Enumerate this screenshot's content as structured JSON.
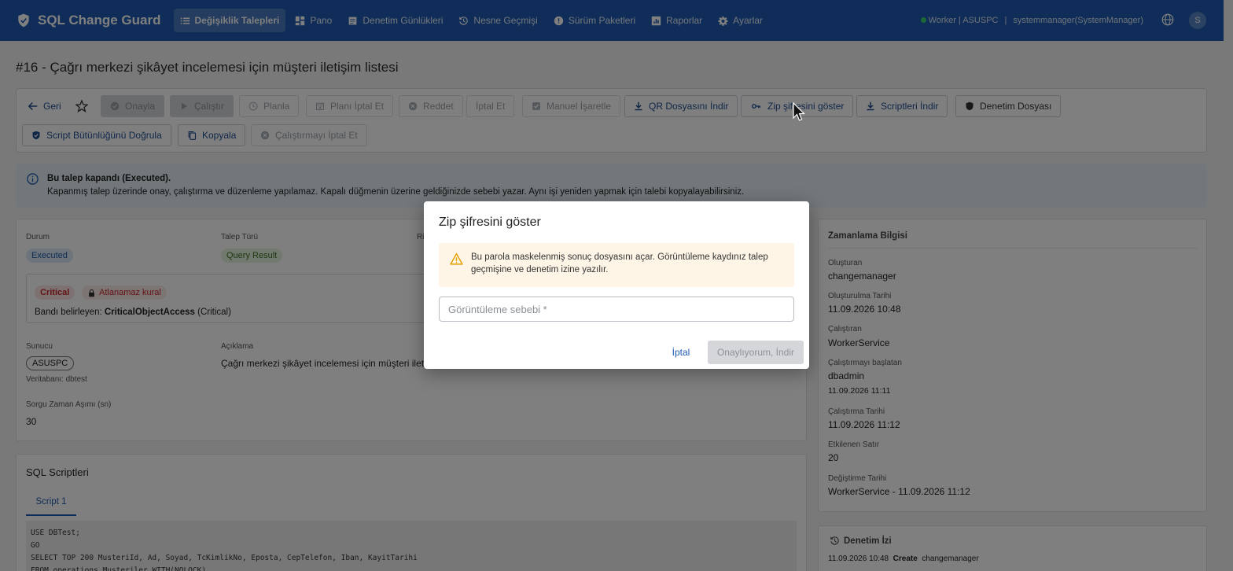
{
  "navbar": {
    "brand": "SQL Change Guard",
    "items": [
      {
        "label": "Değişiklik Talepleri",
        "icon": "list-icon",
        "active": true
      },
      {
        "label": "Pano",
        "icon": "dashboard-icon"
      },
      {
        "label": "Denetim Günlükleri",
        "icon": "log-icon"
      },
      {
        "label": "Nesne Geçmişi",
        "icon": "history-icon"
      },
      {
        "label": "Sürüm Paketleri",
        "icon": "package-icon"
      },
      {
        "label": "Raporlar",
        "icon": "chart-icon"
      },
      {
        "label": "Ayarlar",
        "icon": "gear-icon"
      }
    ],
    "worker_status": "Worker | ASUSPC",
    "user": "systemmanager(SystemManager)",
    "avatar_letter": "S"
  },
  "page": {
    "title": "#16 - Çağrı merkezi şikâyet incelemesi için müşteri iletişim listesi"
  },
  "toolbar": {
    "back": "Geri",
    "approve": "Onayla",
    "execute": "Çalıştır",
    "schedule": "Planla",
    "cancel_schedule": "Planı İptal Et",
    "reject": "Reddet",
    "cancel": "İptal Et",
    "manual_mark": "Manuel İşaretle",
    "download_qr": "QR Dosyasını İndir",
    "show_zip_password": "Zip şifresini göster",
    "download_scripts": "Scriptleri İndir",
    "audit_file": "Denetim Dosyası",
    "verify_integrity": "Script Bütünlüğünü Doğrula",
    "copy": "Kopyala",
    "cancel_execution": "Çalıştırmayı İptal Et"
  },
  "alert": {
    "title": "Bu talep kapandı (Executed).",
    "body": "Kapanmış talep üzerinde onay, çalıştırma ve düzenleme yapılamaz. Kapalı düğmenin üzerine geldiğinizde sebebi yazar. Aynı işi yeniden yapmak için talebi kopyalayabilirsiniz."
  },
  "details": {
    "status_label": "Durum",
    "status_value": "Executed",
    "type_label": "Talep Türü",
    "type_value": "Query Result",
    "risk_label_partial": "Ri",
    "risk_badge": "Critical",
    "lock_badge": "Atlanamaz kural",
    "band_prefix": "Bandı belirleyen:",
    "band_rule": "CriticalObjectAccess",
    "band_suffix": "(Critical)",
    "server_label": "Sunucu",
    "server_value": "ASUSPC",
    "database": "Veritabanı: dbtest",
    "desc_label": "Açıklama",
    "desc_value": "Çağrı merkezi şikâyet incelemesi için müşteri iletişi",
    "timeout_label": "Sorgu Zaman Aşımı (sn)",
    "timeout_value": "30"
  },
  "scripts": {
    "title": "SQL Scriptleri",
    "tab": "Script 1",
    "lines": [
      "USE DBTest;",
      "GO",
      "SELECT TOP 200 MusteriId, Ad, Soyad, TcKimlikNo, Eposta, CepTelefon, Iban, KayitTarihi",
      "FROM operations.Musteriler WITH(NOLOCK)"
    ]
  },
  "timing": {
    "title": "Zamanlama Bilgisi",
    "created_by_label": "Oluşturan",
    "created_by": "changemanager",
    "created_at_label": "Oluşturulma Tarihi",
    "created_at": "11.09.2026 10:48",
    "executor_label": "Çalıştıran",
    "executor": "WorkerService",
    "starter_label": "Çalıştırmayı başlatan",
    "starter": "dbadmin",
    "starter_time": "11.09.2026 11:11",
    "exec_date_label": "Çalıştırma Tarihi",
    "exec_date": "11.09.2026 11:12",
    "affected_label": "Etkilenen Satır",
    "affected": "20",
    "modified_label": "Değiştirme Tarihi",
    "modified": "WorkerService - 11.09.2026 11:12"
  },
  "audit": {
    "title": "Denetim İzi",
    "entry_time": "11.09.2026 10:48",
    "entry_action": "Create",
    "entry_user": "changemanager"
  },
  "modal": {
    "title": "Zip şifresini göster",
    "warning": "Bu parola maskelenmiş sonuç dosyasını açar. Görüntüleme kaydınız talep geçmişine ve denetim izine yazılır.",
    "reason_placeholder": "Görüntüleme sebebi *",
    "reason_value": "",
    "cancel": "İptal",
    "confirm": "Onaylıyorum, İndir"
  },
  "colors": {
    "primary": "#1e5bb0",
    "critical": "#c62828",
    "warning_bg": "#fff5e7",
    "info_bg": "#e3eff5"
  }
}
